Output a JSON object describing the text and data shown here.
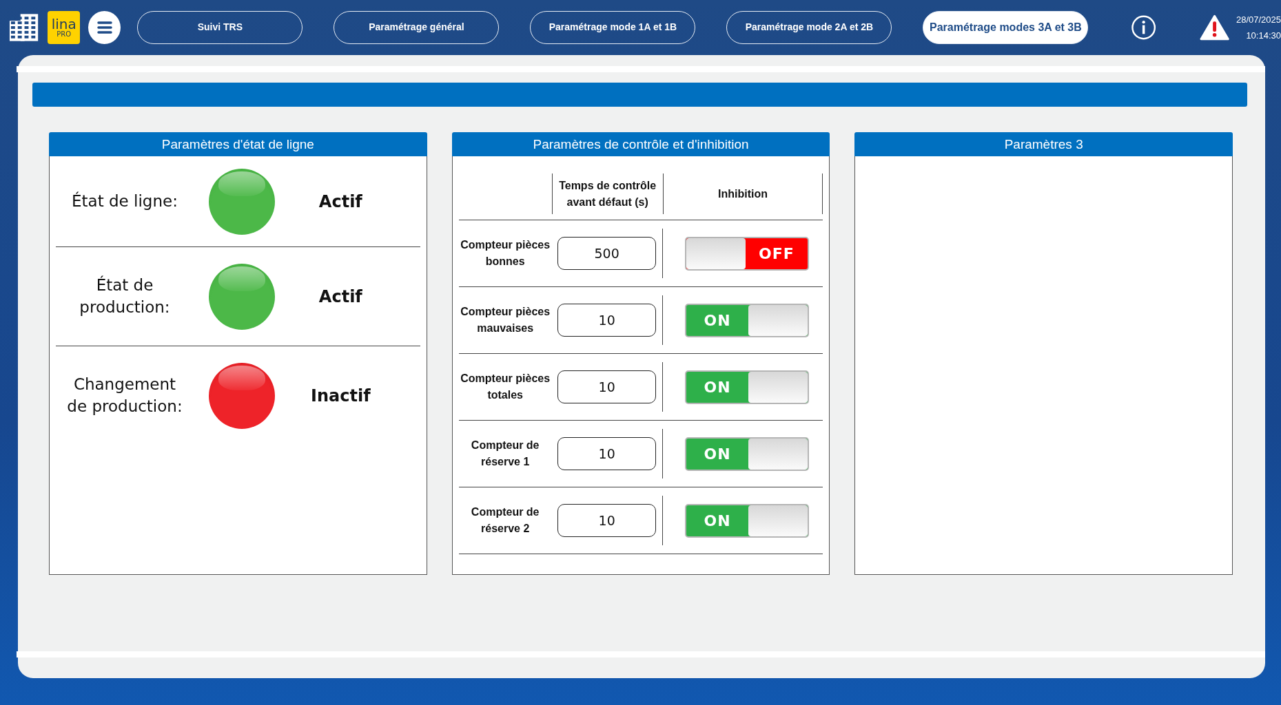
{
  "header": {
    "logo": {
      "line1": "lina",
      "line2": "PRO"
    },
    "nav": [
      {
        "label": "Suivi TRS",
        "selected": false
      },
      {
        "label": "Paramétrage général",
        "selected": false
      },
      {
        "label": "Paramétrage mode 1A et 1B",
        "selected": false
      },
      {
        "label": "Paramétrage mode 2A et 2B",
        "selected": false
      },
      {
        "label": "Paramétrage modes 3A et 3B",
        "selected": true
      }
    ],
    "date": "28/07/2025",
    "time": "10:14:30"
  },
  "line_state_panel": {
    "title": "Paramètres d'état de ligne",
    "rows": [
      {
        "label": "État de ligne:",
        "active": true,
        "status": "Actif"
      },
      {
        "label": "État de production:",
        "active": true,
        "status": "Actif"
      },
      {
        "label": "Changement de production:",
        "active": false,
        "status": "Inactif"
      }
    ]
  },
  "control_panel": {
    "title": "Paramètres de contrôle et d'inhibition",
    "columns": [
      "Temps de contrôle avant défaut (s)",
      "Inhibition"
    ],
    "rows": [
      {
        "label": "Compteur pièces bonnes",
        "value": "500",
        "inhibition": {
          "on": false,
          "label": "OFF"
        }
      },
      {
        "label": "Compteur pièces mauvaises",
        "value": "10",
        "inhibition": {
          "on": true,
          "label": "ON"
        }
      },
      {
        "label": "Compteur pièces totales",
        "value": "10",
        "inhibition": {
          "on": true,
          "label": "ON"
        }
      },
      {
        "label": "Compteur de réserve 1",
        "value": "10",
        "inhibition": {
          "on": true,
          "label": "ON"
        }
      },
      {
        "label": "Compteur de réserve 2",
        "value": "10",
        "inhibition": {
          "on": true,
          "label": "ON"
        }
      }
    ]
  },
  "panel_3": {
    "title": "Paramètres 3"
  }
}
